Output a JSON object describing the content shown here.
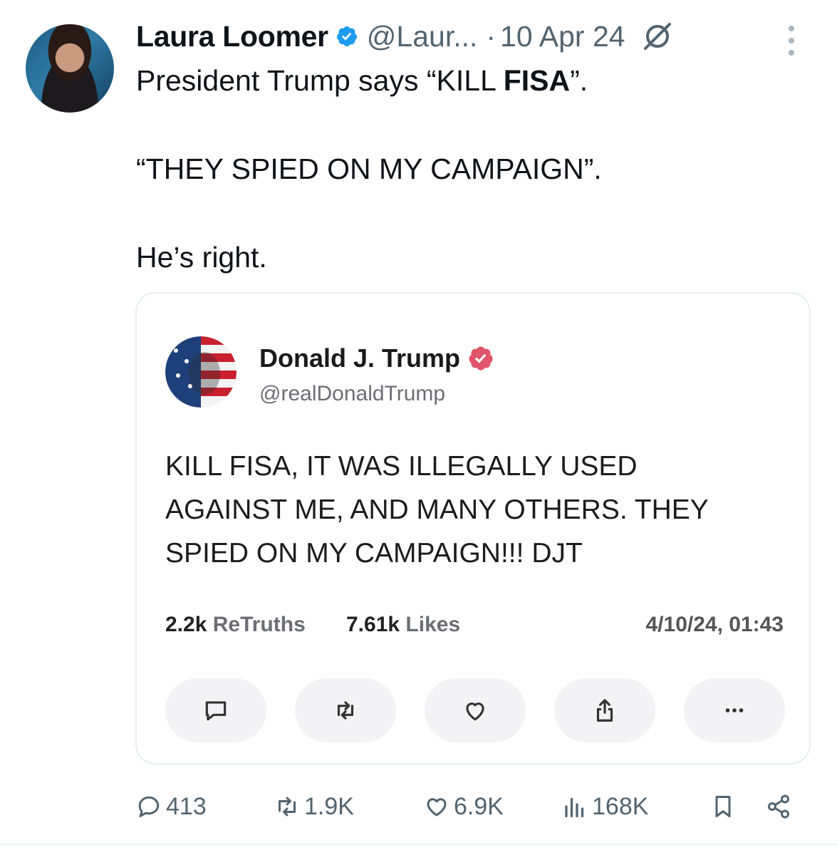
{
  "tweet": {
    "author_name": "Laura Loomer",
    "handle": "@Laur...",
    "separator": "·",
    "date": "10 Apr 24",
    "text_line1_prefix": "President Trump says “KILL ",
    "text_line1_bold": "FISA",
    "text_line1_suffix": "”.",
    "text_line2": "“THEY SPIED ON MY CAMPAIGN”.",
    "text_line3": "He’s right."
  },
  "quote": {
    "author_name": "Donald J. Trump",
    "handle": "@realDonaldTrump",
    "body_line1": "KILL FISA, IT WAS ILLEGALLY USED",
    "body_line2": "AGAINST ME, AND MANY OTHERS. THEY",
    "body_line3": "SPIED ON MY CAMPAIGN!!! DJT",
    "retruths_count": "2.2k",
    "retruths_label": "ReTruths",
    "likes_count": "7.61k",
    "likes_label": "Likes",
    "timestamp": "4/10/24, 01:43",
    "badge_color": "#e0556b"
  },
  "actions": {
    "replies": "413",
    "reposts": "1.9K",
    "likes": "6.9K",
    "views": "168K"
  },
  "icons": {
    "verified": "verified-badge-icon",
    "grok": "grok-icon",
    "more": "more-vertical-icon",
    "reply": "reply-icon",
    "repost": "repost-icon",
    "like": "heart-icon",
    "views": "views-bar-chart-icon",
    "bookmark": "bookmark-icon",
    "share": "share-icon"
  },
  "colors": {
    "verified_blue": "#1d9bf0",
    "secondary_text": "#536471"
  }
}
